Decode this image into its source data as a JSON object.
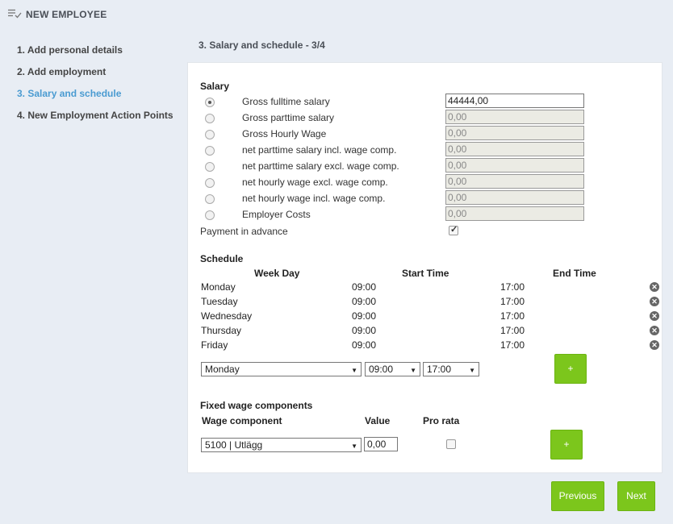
{
  "header": {
    "title": "NEW EMPLOYEE",
    "icon": "list-check-icon"
  },
  "steps": [
    {
      "label": "1. Add personal details"
    },
    {
      "label": "2. Add employment"
    },
    {
      "label": "3. Salary and schedule"
    },
    {
      "label": "4. New Employment Action Points"
    }
  ],
  "section_title": "3. Salary and schedule - 3/4",
  "salary": {
    "heading": "Salary",
    "options": [
      {
        "label": "Gross fulltime salary",
        "value": "44444,00",
        "checked": true
      },
      {
        "label": "Gross parttime salary",
        "value": "0,00",
        "checked": false
      },
      {
        "label": "Gross Hourly Wage",
        "value": "0,00",
        "checked": false
      },
      {
        "label": "net parttime salary incl. wage comp.",
        "value": "0,00",
        "checked": false
      },
      {
        "label": "net parttime salary excl. wage comp.",
        "value": "0,00",
        "checked": false
      },
      {
        "label": "net hourly wage excl. wage comp.",
        "value": "0,00",
        "checked": false
      },
      {
        "label": "net hourly wage incl. wage comp.",
        "value": "0,00",
        "checked": false
      },
      {
        "label": "Employer Costs",
        "value": "0,00",
        "checked": false
      }
    ],
    "payment_in_advance_label": "Payment in advance",
    "payment_in_advance_checked": true
  },
  "schedule": {
    "heading": "Schedule",
    "columns": [
      "Week Day",
      "Start Time",
      "End Time"
    ],
    "rows": [
      {
        "day": "Monday",
        "start": "09:00",
        "end": "17:00"
      },
      {
        "day": "Tuesday",
        "start": "09:00",
        "end": "17:00"
      },
      {
        "day": "Wednesday",
        "start": "09:00",
        "end": "17:00"
      },
      {
        "day": "Thursday",
        "start": "09:00",
        "end": "17:00"
      },
      {
        "day": "Friday",
        "start": "09:00",
        "end": "17:00"
      }
    ],
    "new_day": "Monday",
    "new_start": "09:00",
    "new_end": "17:00",
    "add_label": "+"
  },
  "wage": {
    "heading": "Fixed wage components",
    "columns": [
      "Wage component",
      "Value",
      "Pro rata"
    ],
    "component": "5100 | Utlägg",
    "value": "0,00",
    "add_label": "+"
  },
  "footer": {
    "previous": "Previous",
    "next": "Next"
  },
  "colors": {
    "accent": "#4a9bd1",
    "button_green": "#7cc61c",
    "background": "#e8edf4"
  }
}
